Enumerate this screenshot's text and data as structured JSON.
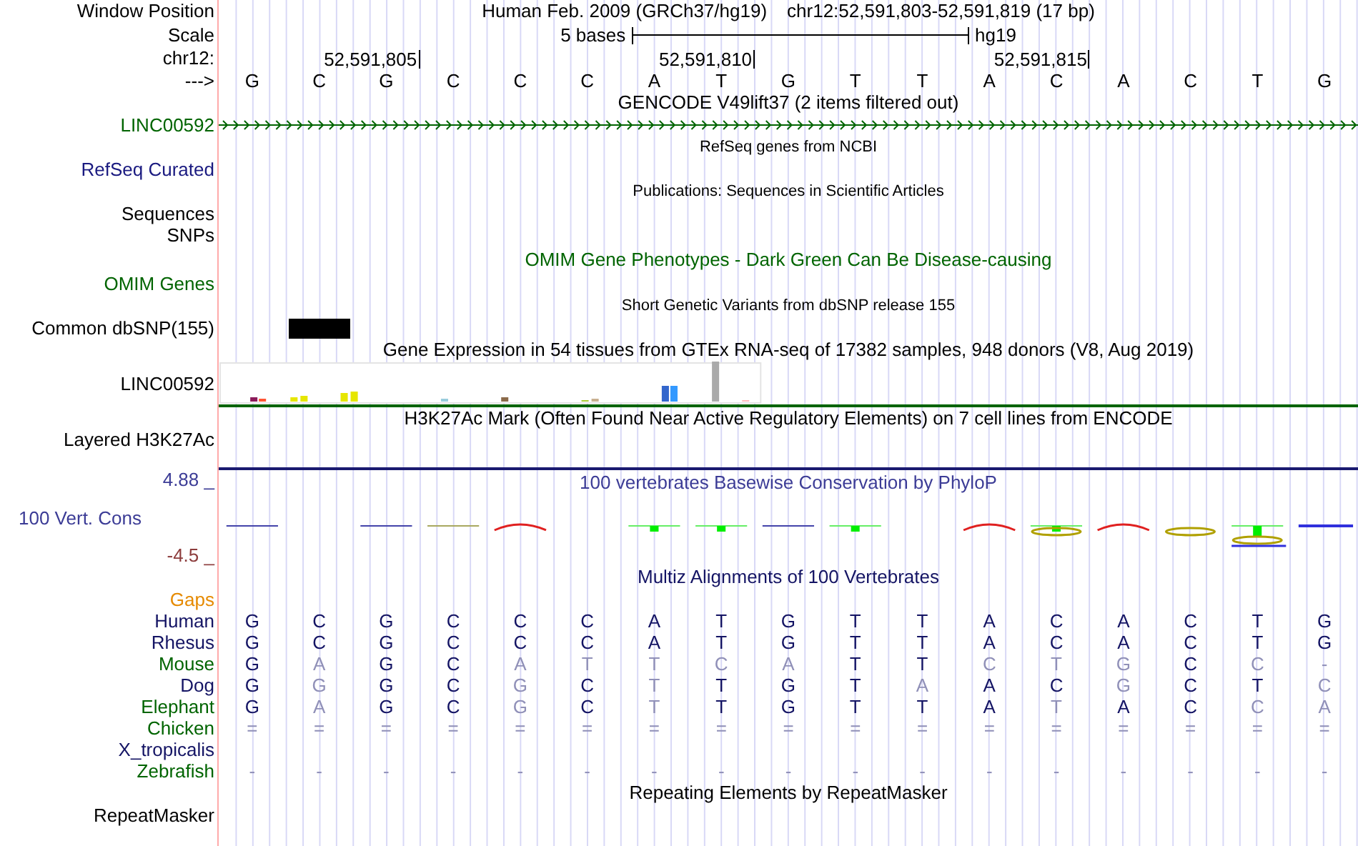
{
  "position": {
    "label": "Window Position",
    "assembly": "Human Feb. 2009 (GRCh37/hg19)",
    "range": "chr12:52,591,803-52,591,819 (17 bp)"
  },
  "scale": {
    "label": "Scale",
    "length": "5 bases",
    "assembly": "hg19"
  },
  "ruler": {
    "label": "chr12:",
    "ticks": [
      "52,591,805",
      "52,591,810",
      "52,591,815"
    ]
  },
  "sequence": {
    "label": "--->",
    "bases": [
      "G",
      "C",
      "G",
      "C",
      "C",
      "C",
      "A",
      "T",
      "G",
      "T",
      "T",
      "A",
      "C",
      "A",
      "C",
      "T",
      "G"
    ]
  },
  "tracks": [
    {
      "kind": "gene",
      "title": "GENCODE V49lift37 (2 items filtered out)",
      "rows": [
        {
          "label": "LINC00592",
          "color": "#006400"
        }
      ]
    },
    {
      "kind": "refseq",
      "title": "RefSeq genes from NCBI",
      "rows": [
        {
          "label": "RefSeq Curated",
          "color": "#1a1a80"
        }
      ]
    },
    {
      "kind": "publications",
      "title": "Publications: Sequences in Scientific Articles",
      "rows": [
        {
          "label": "Sequences",
          "color": "#000000"
        },
        {
          "label": "SNPs",
          "color": "#000000"
        }
      ]
    },
    {
      "kind": "omim",
      "title": "OMIM Gene Phenotypes - Dark Green Can Be Disease-causing",
      "rows": [
        {
          "label": "OMIM Genes",
          "color": "#006400"
        }
      ]
    },
    {
      "kind": "dbsnp",
      "title": "Short Genetic Variants from dbSNP release 155",
      "rows": [
        {
          "label": "Common dbSNP(155)",
          "color": "#000000"
        }
      ]
    },
    {
      "kind": "gtex",
      "title": "Gene Expression in 54 tissues from GTEx RNA-seq of 17382 samples, 948 donors (V8, Aug 2019)",
      "rows": [
        {
          "label": "LINC00592",
          "color": "#000000"
        }
      ]
    },
    {
      "kind": "h3k27ac",
      "title": "H3K27Ac Mark (Often Found Near Active Regulatory Elements) on 7 cell lines from ENCODE",
      "rows": [
        {
          "label": "Layered H3K27Ac",
          "color": "#000000"
        }
      ]
    },
    {
      "kind": "conservation",
      "title": "100 vertebrates Basewise Conservation by PhyloP",
      "axis_max": "4.88 _",
      "axis_min": "-4.5 _",
      "rows": [
        {
          "label": "100 Vert. Cons",
          "color": "#3c3c96"
        }
      ]
    },
    {
      "kind": "multiz",
      "title": "Multiz Alignments of 100 Vertebrates",
      "rows": [
        {
          "label": "Gaps",
          "color": "#e68a00"
        },
        {
          "label": "Human",
          "color": "#141464",
          "bases": [
            "G",
            "C",
            "G",
            "C",
            "C",
            "C",
            "A",
            "T",
            "G",
            "T",
            "T",
            "A",
            "C",
            "A",
            "C",
            "T",
            "G"
          ],
          "match": [
            true,
            true,
            true,
            true,
            true,
            true,
            true,
            true,
            true,
            true,
            true,
            true,
            true,
            true,
            true,
            true,
            true
          ]
        },
        {
          "label": "Rhesus",
          "color": "#141464",
          "bases": [
            "G",
            "C",
            "G",
            "C",
            "C",
            "C",
            "A",
            "T",
            "G",
            "T",
            "T",
            "A",
            "C",
            "A",
            "C",
            "T",
            "G"
          ],
          "match": [
            true,
            true,
            true,
            true,
            true,
            true,
            true,
            true,
            true,
            true,
            true,
            true,
            true,
            true,
            true,
            true,
            true
          ]
        },
        {
          "label": "Mouse",
          "color": "#006400",
          "bases": [
            "G",
            "A",
            "G",
            "C",
            "A",
            "T",
            "T",
            "C",
            "A",
            "T",
            "T",
            "C",
            "T",
            "G",
            "C",
            "C",
            "-"
          ],
          "match": [
            true,
            false,
            true,
            true,
            false,
            false,
            false,
            false,
            false,
            true,
            true,
            false,
            false,
            false,
            true,
            false,
            false
          ]
        },
        {
          "label": "Dog",
          "color": "#141464",
          "bases": [
            "G",
            "G",
            "G",
            "C",
            "G",
            "C",
            "T",
            "T",
            "G",
            "T",
            "A",
            "A",
            "C",
            "G",
            "C",
            "T",
            "C"
          ],
          "match": [
            true,
            false,
            true,
            true,
            false,
            true,
            false,
            true,
            true,
            true,
            false,
            true,
            true,
            false,
            true,
            true,
            false
          ]
        },
        {
          "label": "Elephant",
          "color": "#006400",
          "bases": [
            "G",
            "A",
            "G",
            "C",
            "G",
            "C",
            "T",
            "T",
            "G",
            "T",
            "T",
            "A",
            "T",
            "A",
            "C",
            "C",
            "A"
          ],
          "match": [
            true,
            false,
            true,
            true,
            false,
            true,
            false,
            true,
            true,
            true,
            true,
            true,
            false,
            true,
            true,
            false,
            false
          ]
        },
        {
          "label": "Chicken",
          "color": "#006400",
          "bases": [
            "=",
            "=",
            "=",
            "=",
            "=",
            "=",
            "=",
            "=",
            "=",
            "=",
            "=",
            "=",
            "=",
            "=",
            "=",
            "=",
            "="
          ],
          "match": [
            false,
            false,
            false,
            false,
            false,
            false,
            false,
            false,
            false,
            false,
            false,
            false,
            false,
            false,
            false,
            false,
            false
          ]
        },
        {
          "label": "X_tropicalis",
          "color": "#141464"
        },
        {
          "label": "Zebrafish",
          "color": "#006400",
          "bases": [
            "-",
            "-",
            "-",
            "-",
            "-",
            "-",
            "-",
            "-",
            "-",
            "-",
            "-",
            "-",
            "-",
            "-",
            "-",
            "-",
            "-"
          ],
          "match": [
            false,
            false,
            false,
            false,
            false,
            false,
            false,
            false,
            false,
            false,
            false,
            false,
            false,
            false,
            false,
            false,
            false
          ]
        }
      ]
    },
    {
      "kind": "repeats",
      "title": "Repeating Elements by RepeatMasker",
      "rows": [
        {
          "label": "RepeatMasker",
          "color": "#000000"
        }
      ]
    }
  ]
}
